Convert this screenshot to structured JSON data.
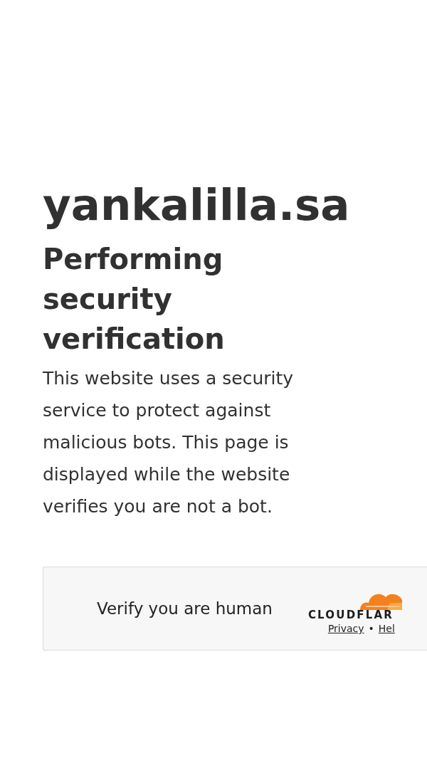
{
  "site_title": "yankalilla.sa",
  "heading": "Performing security verification",
  "description": "This website uses a security service to protect against malicious bots. This page is displayed while the website verifies you are not a bot.",
  "challenge": {
    "label": "Verify you are human",
    "brand": "CLOUDFLAR",
    "links": [
      {
        "label": "Privacy"
      },
      {
        "label": "Hel"
      }
    ],
    "separator": "•"
  }
}
